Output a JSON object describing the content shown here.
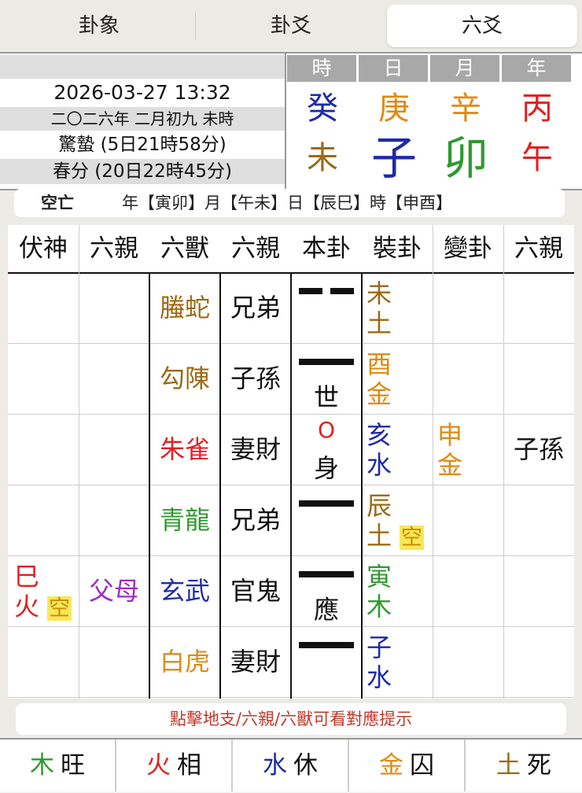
{
  "tabs": [
    "卦象",
    "卦爻",
    "六爻"
  ],
  "info": {
    "datetime": "2026-03-27 13:32",
    "lunar": "二〇二六年 二月初九 未時",
    "term1": "驚蟄 (5日21時58分)",
    "term2": "春分 (20日22時45分)"
  },
  "pillars": {
    "headers": [
      "時",
      "日",
      "月",
      "年"
    ],
    "stems": [
      "癸",
      "庚",
      "辛",
      "丙"
    ],
    "branches": [
      "未",
      "子",
      "卯",
      "午"
    ],
    "stem_colors": [
      "#1f2aa8",
      "#e08a12",
      "#e08a12",
      "#e02020"
    ],
    "branch_colors": [
      "#9b6a16",
      "#1f2aa8",
      "#2f9a2f",
      "#e02020"
    ]
  },
  "void": {
    "title": "空亡",
    "value": "年【寅卯】月【午未】日【辰巳】時【申酉】"
  },
  "table": {
    "headers": [
      "伏神",
      "六親",
      "六獸",
      "六親",
      "本卦",
      "裝卦",
      "變卦",
      "六親"
    ],
    "rows": [
      {
        "beast": "螣蛇",
        "beast_color": "#9b6a16",
        "relation": "兄弟",
        "line": "yin",
        "mark": "",
        "branch": "未",
        "element": "土",
        "branch_color": "#9b6a16",
        "empty": ""
      },
      {
        "beast": "勾陳",
        "beast_color": "#9b6a16",
        "relation": "子孫",
        "line": "yang",
        "mark": "世",
        "branch": "酉",
        "element": "金",
        "branch_color": "#e08a12",
        "empty": ""
      },
      {
        "beast": "朱雀",
        "beast_color": "#e02020",
        "relation": "妻財",
        "line": "moving",
        "moving_symbol": "O",
        "mark": "身",
        "branch": "亥",
        "element": "水",
        "branch_color": "#1f2aa8",
        "empty": "",
        "change_branch": "申",
        "change_element": "金",
        "change_color": "#e08a12",
        "change_relation": "子孫"
      },
      {
        "beast": "青龍",
        "beast_color": "#2f9a2f",
        "relation": "兄弟",
        "line": "yang",
        "mark": "",
        "branch": "辰",
        "element": "土",
        "branch_color": "#9b6a16",
        "empty": "空"
      },
      {
        "beast": "玄武",
        "beast_color": "#1f2aa8",
        "relation": "官鬼",
        "line": "yang",
        "mark": "應",
        "branch": "寅",
        "element": "木",
        "branch_color": "#2f9a2f",
        "empty": "",
        "hidden_branch": "巳",
        "hidden_element": "火",
        "hidden_color": "#e02020",
        "hidden_empty": "空",
        "hidden_relation": "父母",
        "hidden_relation_color": "#9a2fc4"
      },
      {
        "beast": "白虎",
        "beast_color": "#e08a12",
        "relation": "妻財",
        "line": "yang",
        "mark": "",
        "branch": "子",
        "element": "水",
        "branch_color": "#1f2aa8",
        "empty": ""
      }
    ]
  },
  "hint": "點擊地支/六親/六獸可看對應提示",
  "seasons": [
    {
      "el": "木",
      "state": "旺",
      "color": "#2f9a2f"
    },
    {
      "el": "火",
      "state": "相",
      "color": "#e02020"
    },
    {
      "el": "水",
      "state": "休",
      "color": "#1f2aa8"
    },
    {
      "el": "金",
      "state": "囚",
      "color": "#e08a12"
    },
    {
      "el": "土",
      "state": "死",
      "color": "#9b6a16"
    }
  ]
}
